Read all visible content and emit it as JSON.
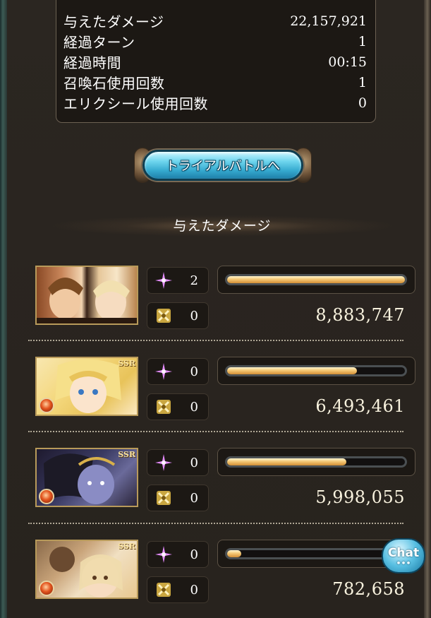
{
  "stats": [
    {
      "label": "与えたダメージ",
      "value": "22,157,921"
    },
    {
      "label": "経過ターン",
      "value": "1"
    },
    {
      "label": "経過時間",
      "value": "00:15"
    },
    {
      "label": "召喚石使用回数",
      "value": "1"
    },
    {
      "label": "エリクシール使用回数",
      "value": "0"
    }
  ],
  "trial_button": {
    "label": "トライアルバトルへ"
  },
  "section_title": "与えたダメージ",
  "party": [
    {
      "name_badge": "",
      "ougi": "2",
      "cure": "0",
      "damage": "8,883,747",
      "damage_fill": 1.0
    },
    {
      "name_badge": "SSR",
      "ougi": "0",
      "cure": "0",
      "damage": "6,493,461",
      "damage_fill": 0.73
    },
    {
      "name_badge": "SSR",
      "ougi": "0",
      "cure": "0",
      "damage": "5,998,055",
      "damage_fill": 0.67
    },
    {
      "name_badge": "SSR",
      "ougi": "0",
      "cure": "0",
      "damage": "782,658",
      "damage_fill": 0.08
    }
  ],
  "icons": {
    "ougi": "pink-sparkle-icon",
    "cure": "crossed-swords-icon",
    "element": "fire-element-icon"
  },
  "chat": {
    "label": "Chat",
    "dots": "•••"
  },
  "colors": {
    "panel": "#2a2520",
    "bar_fill": "#f4c774",
    "button": "#35a9cf",
    "text": "#ffffff"
  }
}
